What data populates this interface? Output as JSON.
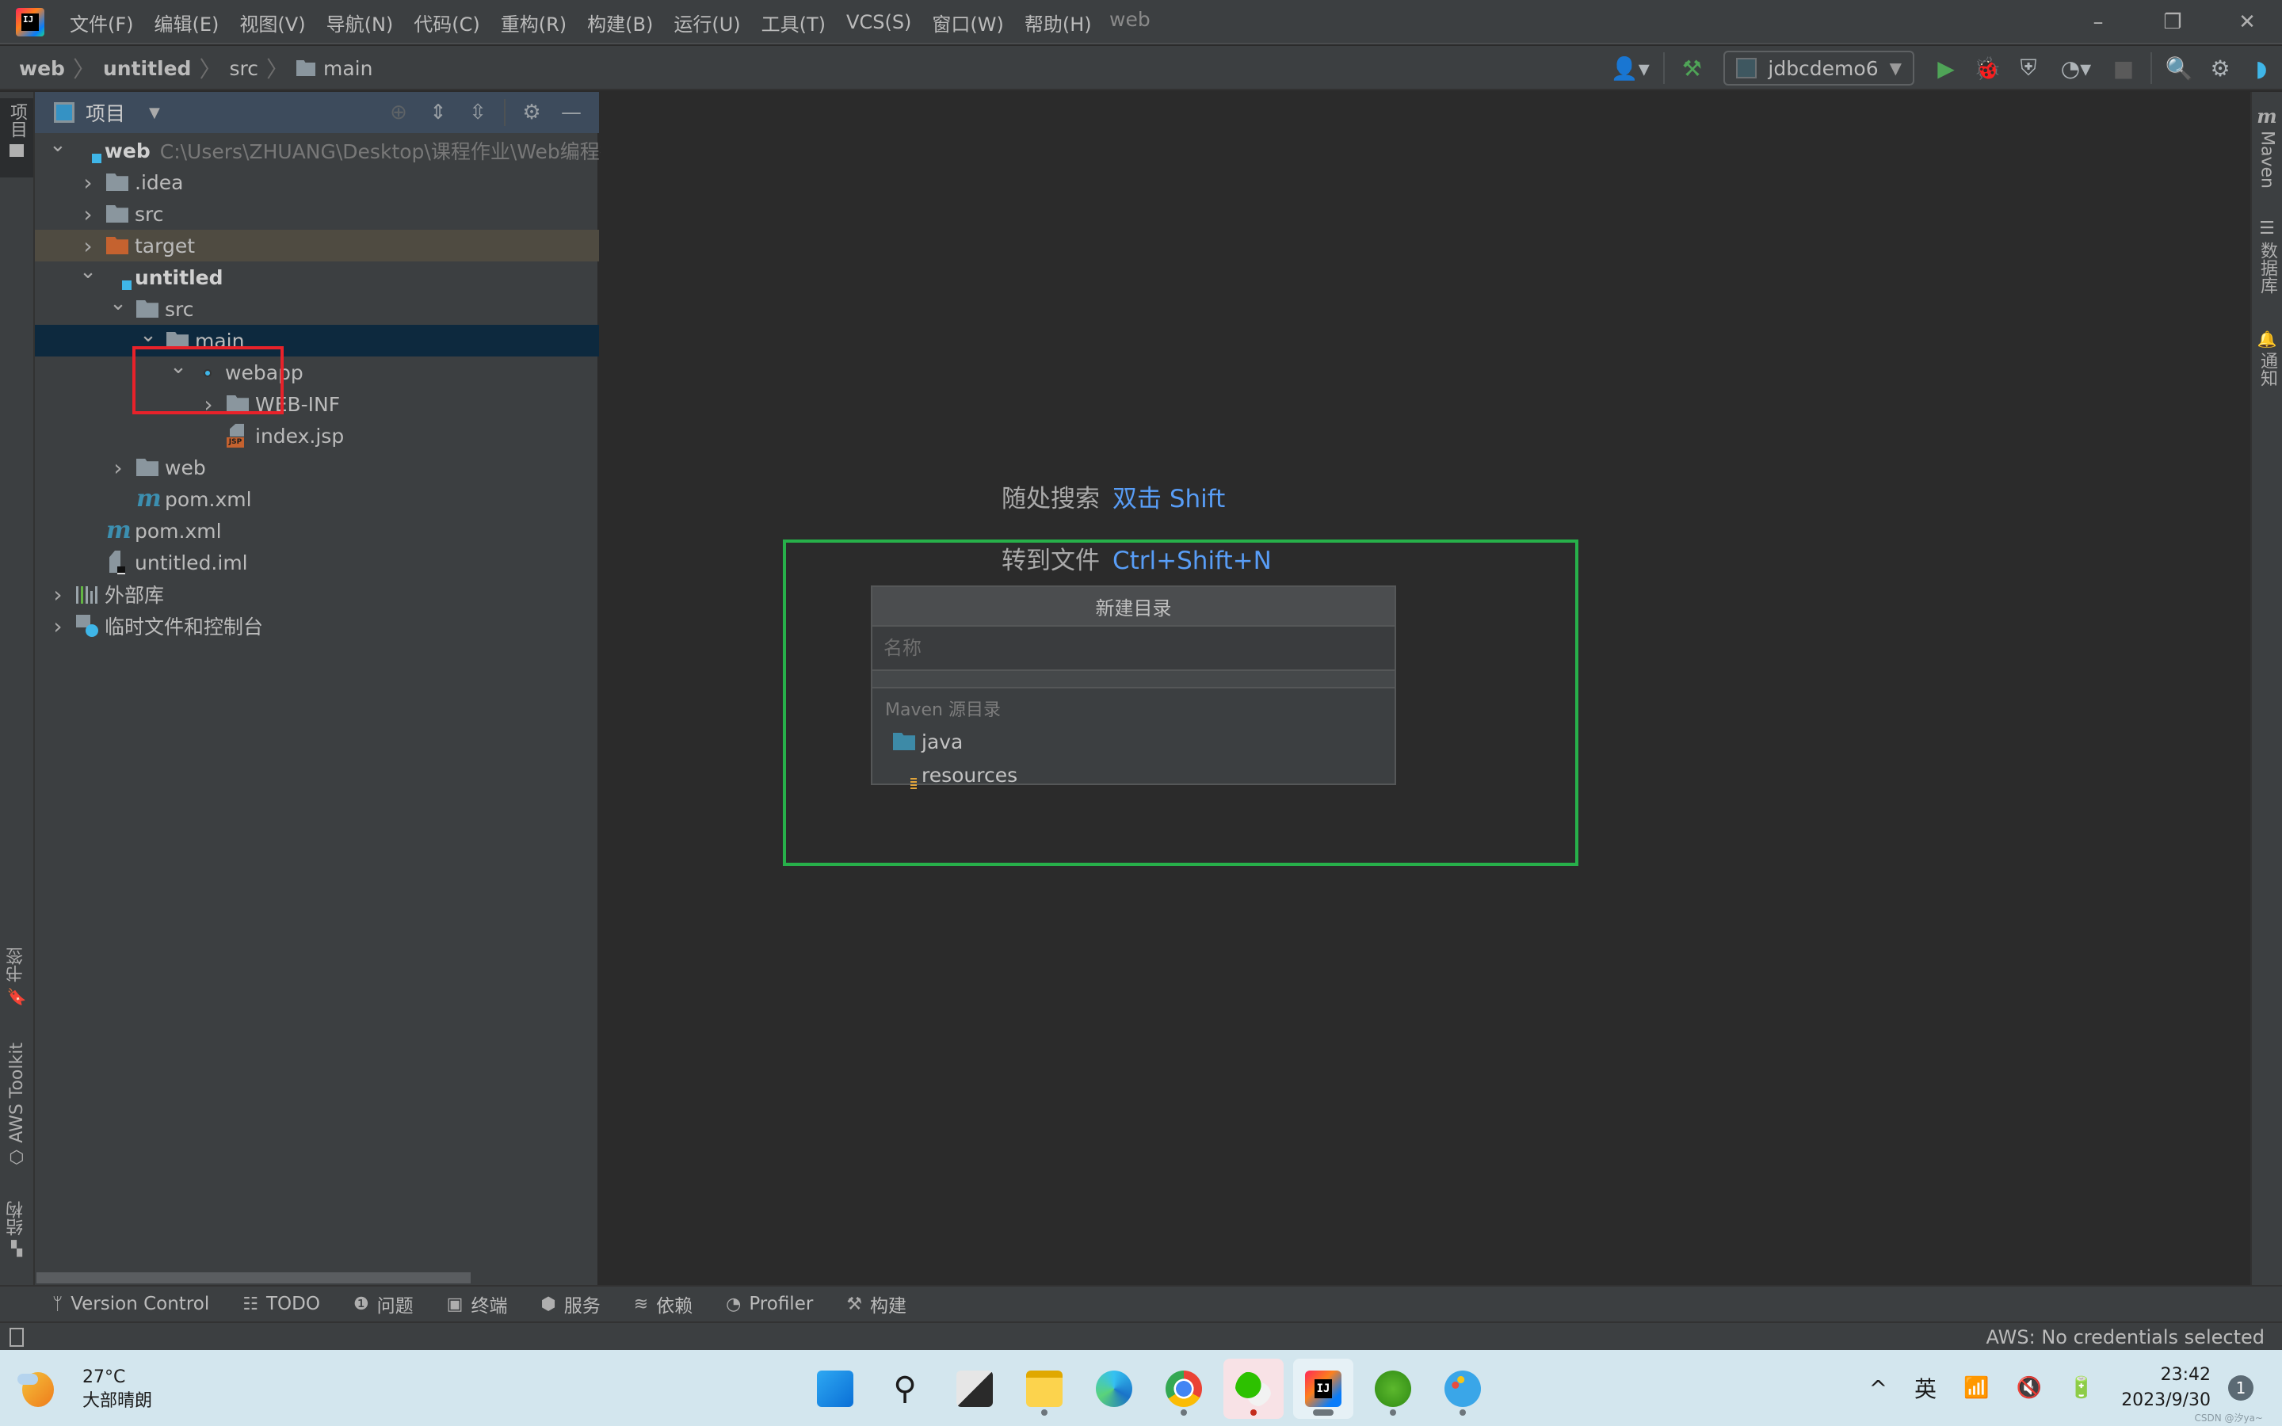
{
  "titlebar": {
    "window_title": "web",
    "menu": [
      "文件(F)",
      "编辑(E)",
      "视图(V)",
      "导航(N)",
      "代码(C)",
      "重构(R)",
      "构建(B)",
      "运行(U)",
      "工具(T)",
      "VCS(S)",
      "窗口(W)",
      "帮助(H)"
    ],
    "logo_text": "IJ",
    "window_controls": {
      "minimize": "–",
      "restore": "❐",
      "close": "✕"
    }
  },
  "navbar": {
    "breadcrumb": [
      "web",
      "untitled",
      "src",
      "main"
    ],
    "run_config": "jdbcdemo6",
    "icons": [
      "vcs-user-icon",
      "build-hammer-icon",
      "run-icon",
      "debug-icon",
      "coverage-icon",
      "profile-icon",
      "stop-icon",
      "search-icon",
      "settings-icon",
      "toolbox-icon"
    ]
  },
  "left_stripe": {
    "top_tab": "项目",
    "bottom_tabs": [
      "书签",
      "AWS Toolkit",
      "结构"
    ]
  },
  "project_panel": {
    "title": "项目",
    "tree": [
      {
        "depth": 0,
        "expanded": true,
        "icon": "module",
        "name": "web",
        "bold": true,
        "hint": "C:\\Users\\ZHUANG\\Desktop\\课程作业\\Web编程技术"
      },
      {
        "depth": 1,
        "expanded": false,
        "icon": "folder",
        "name": ".idea"
      },
      {
        "depth": 1,
        "expanded": false,
        "icon": "folder",
        "name": "src"
      },
      {
        "depth": 1,
        "expanded": false,
        "icon": "folder-excluded",
        "name": "target",
        "state": "excluded"
      },
      {
        "depth": 1,
        "expanded": true,
        "icon": "module",
        "name": "untitled",
        "bold": true
      },
      {
        "depth": 2,
        "expanded": true,
        "icon": "folder",
        "name": "src"
      },
      {
        "depth": 3,
        "expanded": true,
        "icon": "folder",
        "name": "main",
        "state": "selected"
      },
      {
        "depth": 4,
        "expanded": true,
        "icon": "web-folder",
        "name": "webapp"
      },
      {
        "depth": 5,
        "expanded": false,
        "icon": "folder",
        "name": "WEB-INF"
      },
      {
        "depth": 5,
        "leaf": true,
        "icon": "jsp",
        "name": "index.jsp"
      },
      {
        "depth": 2,
        "expanded": false,
        "icon": "folder",
        "name": "web"
      },
      {
        "depth": 2,
        "leaf": true,
        "icon": "maven",
        "name": "pom.xml"
      },
      {
        "depth": 1,
        "leaf": true,
        "icon": "maven",
        "name": "pom.xml"
      },
      {
        "depth": 1,
        "leaf": true,
        "icon": "iml",
        "name": "untitled.iml"
      },
      {
        "depth": 0,
        "expanded": false,
        "icon": "library",
        "name": "外部库"
      },
      {
        "depth": 0,
        "expanded": false,
        "icon": "scratch",
        "name": "临时文件和控制台"
      }
    ]
  },
  "editor": {
    "hints": [
      {
        "label": "随处搜索",
        "shortcut": "双击 Shift"
      },
      {
        "label": "转到文件",
        "shortcut": "Ctrl+Shift+N"
      }
    ]
  },
  "new_directory_popup": {
    "title": "新建目录",
    "input_value": "",
    "input_placeholder": "名称",
    "group_label": "Maven 源目录",
    "suggestions": [
      "java",
      "resources"
    ]
  },
  "annotations": {
    "red_box_color": "#e8222a",
    "green_box_color": "#27b04a"
  },
  "right_stripe": {
    "tabs": [
      "Maven",
      "数据库",
      "通知"
    ]
  },
  "bottom_tools": [
    "Version Control",
    "TODO",
    "问题",
    "终端",
    "服务",
    "依赖",
    "Profiler",
    "构建"
  ],
  "status_bar": {
    "aws": "AWS: No credentials selected"
  },
  "taskbar": {
    "weather_temp": "27°C",
    "weather_desc": "大部晴朗",
    "apps": [
      "start",
      "search",
      "task-view",
      "file-explorer",
      "edge",
      "chrome",
      "wechat",
      "intellij-idea",
      "app-green",
      "paint"
    ],
    "tray": {
      "overflow": "^",
      "ime": "英",
      "wifi": "wifi",
      "volume": "muted",
      "battery": "charging"
    },
    "time": "23:42",
    "date": "2023/9/30",
    "notification_count": "1",
    "watermark": "CSDN @汐ya~"
  }
}
